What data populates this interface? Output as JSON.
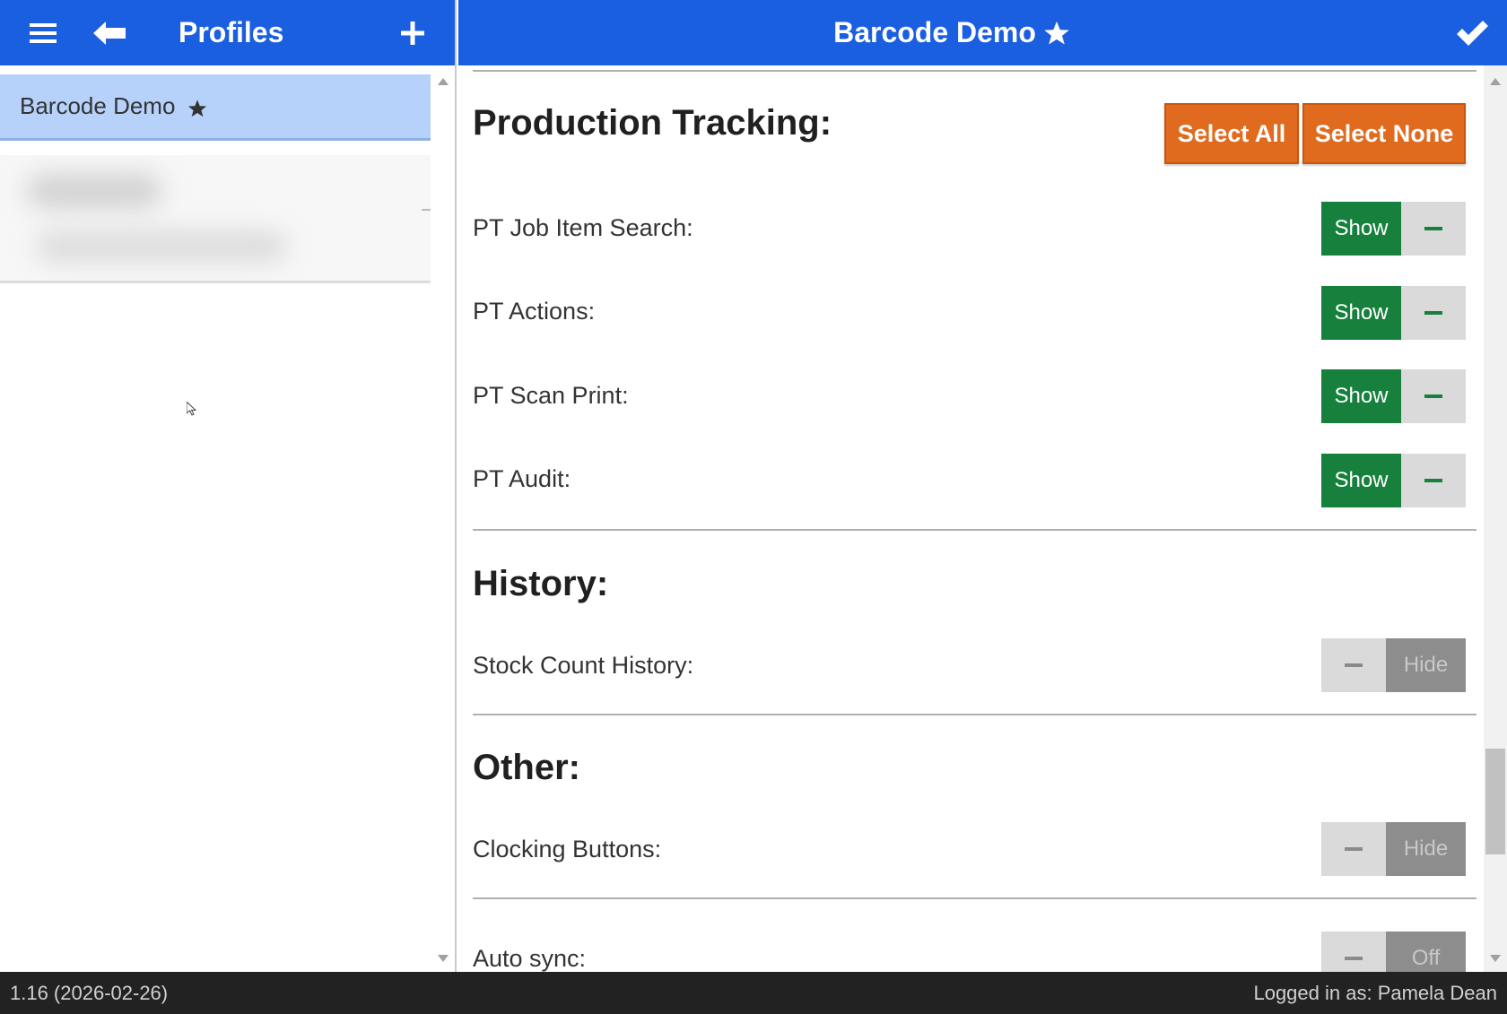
{
  "left_panel": {
    "title": "Profiles",
    "icons": {
      "menu": "hamburger-menu-icon",
      "back": "arrow-left-icon",
      "add": "plus-icon"
    },
    "selected_profile": {
      "label": "Barcode Demo",
      "icon": "star-icon"
    }
  },
  "right_panel": {
    "title": "Barcode Demo",
    "title_icon": "star-icon",
    "confirm_icon": "checkmark-icon"
  },
  "sections": {
    "production_tracking": {
      "heading": "Production Tracking:",
      "select_all": "Select All",
      "select_none": "Select None",
      "rows": [
        {
          "label": "PT Job Item Search:",
          "state": "Show"
        },
        {
          "label": "PT Actions:",
          "state": "Show"
        },
        {
          "label": "PT Scan Print:",
          "state": "Show"
        },
        {
          "label": "PT Audit:",
          "state": "Show"
        }
      ]
    },
    "history": {
      "heading": "History:",
      "rows": [
        {
          "label": "Stock Count History:",
          "state": "Hide"
        }
      ]
    },
    "other": {
      "heading": "Other:",
      "rows": [
        {
          "label": "Clocking Buttons:",
          "state": "Hide"
        },
        {
          "label": "Auto sync:",
          "state": "Off"
        }
      ]
    }
  },
  "footer": {
    "version": "1.16 (2026-02-26)",
    "logged_in": "Logged in as: Pamela Dean"
  },
  "colors": {
    "topbar": "#1a5fe0",
    "selected_item": "#b6d2fa",
    "show_green": "#16803c",
    "select_orange": "#e06b1f",
    "footer": "#222222"
  }
}
